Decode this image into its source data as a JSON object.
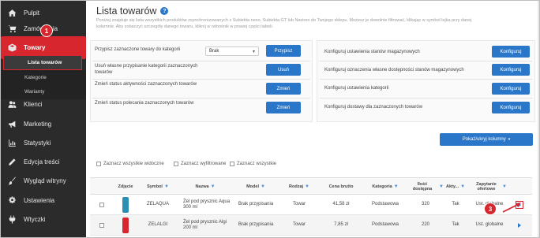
{
  "sidebar": {
    "items": [
      {
        "label": "Pulpit",
        "icon": "home-icon"
      },
      {
        "label": "Zamówienia",
        "icon": "cart-icon"
      },
      {
        "label": "Towary",
        "icon": "box-icon"
      },
      {
        "label": "Klienci",
        "icon": "users-icon"
      },
      {
        "label": "Marketing",
        "icon": "megaphone-icon"
      },
      {
        "label": "Statystyki",
        "icon": "chart-icon"
      },
      {
        "label": "Edycja treści",
        "icon": "pencil-icon"
      },
      {
        "label": "Wygląd witryny",
        "icon": "brush-icon"
      },
      {
        "label": "Ustawienia",
        "icon": "gear-icon"
      },
      {
        "label": "Wtyczki",
        "icon": "plug-icon"
      }
    ],
    "subitems": [
      {
        "label": "Lista towarów"
      },
      {
        "label": "Kategorie"
      },
      {
        "label": "Warianty"
      }
    ]
  },
  "badges": [
    "1",
    "2",
    "3"
  ],
  "page": {
    "title": "Lista towarów",
    "help": "?",
    "description": "Poniżej znajduje się lista wszystkich produktów zsynchronizowanych z Subiekta nexo, Subiekta GT lub Navireo do Twojego sklepu. Możesz je dowolnie filtrować, klikając w symbol lejka przy danej kolumnie. Aby zobaczyć szczegóły danego towaru, kliknij w odnośnik w prawej części tabeli."
  },
  "left_panel": {
    "row1_label": "Przypisz zaznaczone towary do kategorii",
    "row1_select": "Brak",
    "row1_button": "Przypisz",
    "row2_label": "Usuń własne przypisanie kategorii zaznaczonych towarów",
    "row2_button": "Usuń",
    "row3_label": "Zmień status aktywności zaznaczonych towarów",
    "row3_button": "Zmień",
    "row4_label": "Zmień status polecania zaznaczonych towarów",
    "row4_button": "Zmień"
  },
  "right_panel": {
    "row1_label": "Konfiguruj ustawienia stanów magazynowych",
    "row2_label": "Konfiguruj oznaczenia własne dostępności stanów magazynowych",
    "row3_label": "Konfiguruj ustawienia kategorii",
    "row4_label": "Konfiguruj dostawy dla zaznaczonych towarów",
    "button": "Konfiguruj"
  },
  "columns_button": "Pokaż/ukryj kolumny",
  "checks": {
    "visible": "Zaznacz wszystkie widoczne",
    "filtered": "Zaznacz wyfiltrowane",
    "all": "Zaznacz wszystkie"
  },
  "table": {
    "headers": [
      "Zdjęcie",
      "Symbol",
      "Nazwa",
      "Model",
      "Rodzaj",
      "Cena brutto",
      "Kategoria",
      "Ilość dostępna",
      "Akty...",
      "Zapytanie ofertowe"
    ],
    "rows": [
      {
        "symbol": "ZELAQUA",
        "name": "Żel pod prysznic Aqua 300 ml",
        "model": "Brak przypisania",
        "type": "Towar",
        "price": "41,58 zł",
        "category": "Podstawowa",
        "qty": "320",
        "active": "Tak",
        "offer": "Ust. globalne",
        "color": "#2b8fb3"
      },
      {
        "symbol": "ZELALGI",
        "name": "Żel pod prysznic Algi 200 ml",
        "model": "Brak przypisania",
        "type": "Towar",
        "price": "7,85 zł",
        "category": "Podstawowa",
        "qty": "220",
        "active": "Tak",
        "offer": "Ust. globalne",
        "color": "#d9262e"
      }
    ]
  },
  "colors": {
    "accent": "#d7262e",
    "primary": "#2a77c9",
    "sidebar": "#2b2b2b"
  }
}
